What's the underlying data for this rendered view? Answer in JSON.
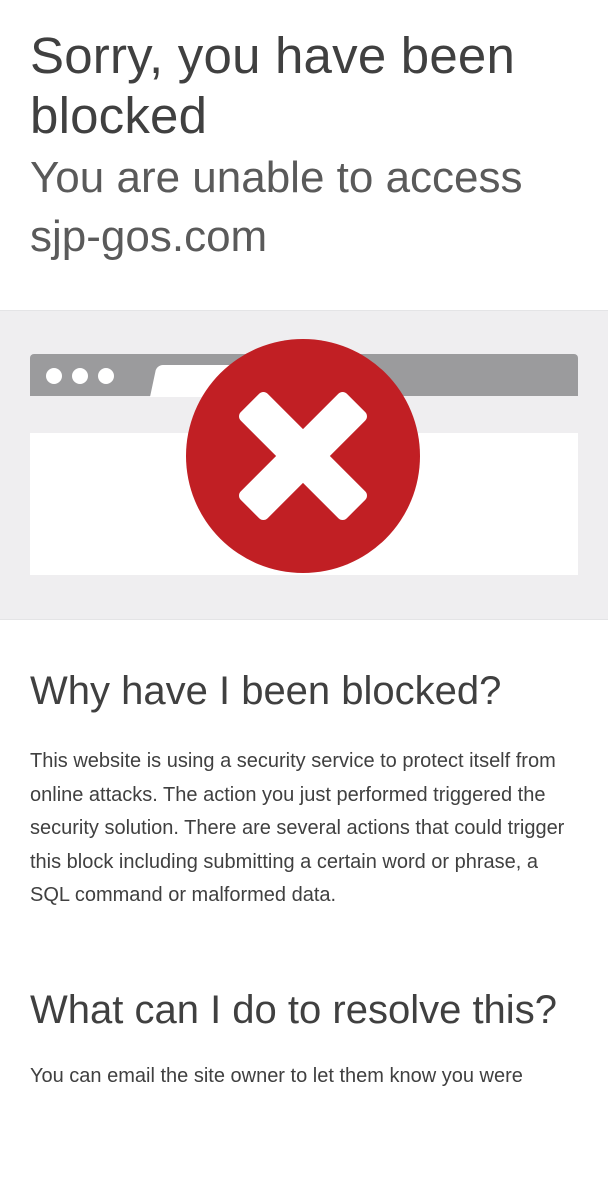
{
  "header": {
    "title": "Sorry, you have been blocked",
    "subtitle": "You are unable to access sjp-gos.com"
  },
  "illustration": {
    "icon": "blocked-x-icon",
    "colors": {
      "circle": "#c11f24",
      "browser_bar": "#9b9b9d",
      "banner_background": "#efeef0"
    }
  },
  "why": {
    "heading": "Why have I been blocked?",
    "body": "This website is using a security service to protect itself from online attacks. The action you just performed triggered the security solution. There are several actions that could trigger this block including submitting a certain word or phrase, a SQL command or malformed data."
  },
  "resolve": {
    "heading": "What can I do to resolve this?",
    "body": "You can email the site owner to let them know you were"
  }
}
